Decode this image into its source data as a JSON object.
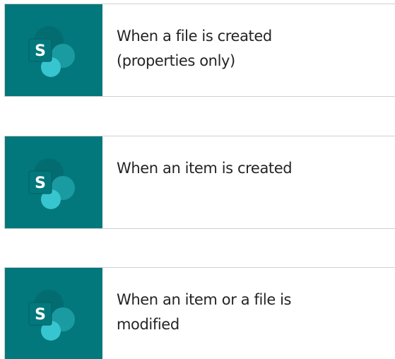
{
  "accent_color": "#03787c",
  "triggers": [
    {
      "icon": "sharepoint-icon",
      "title": "When a file is created (properties only)"
    },
    {
      "icon": "sharepoint-icon",
      "title": "When an item is created"
    },
    {
      "icon": "sharepoint-icon",
      "title": "When an item or a file is modified"
    }
  ]
}
